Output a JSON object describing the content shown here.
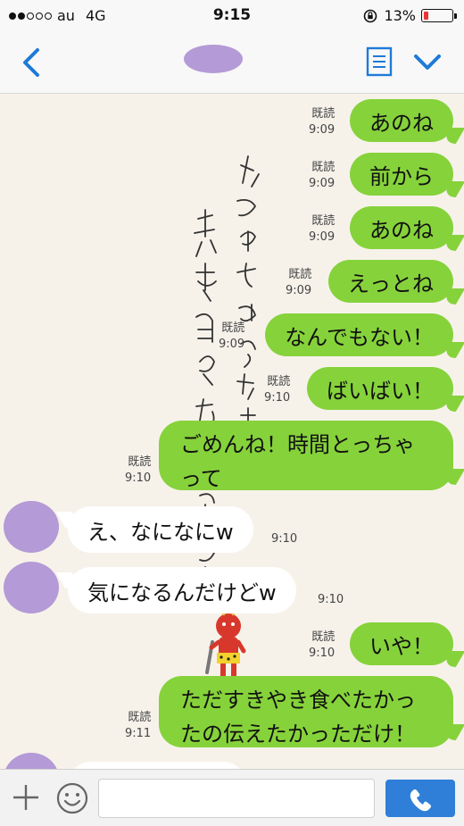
{
  "status_bar": {
    "carrier": "au",
    "network": "4G",
    "time": "9:15",
    "battery": "13%",
    "battery_level": 0.13,
    "signal_bars_filled": 2,
    "signal_bars_total": 5
  },
  "colors": {
    "outgoing_bubble": "#86d23b",
    "incoming_bubble": "#ffffff",
    "accent": "#1f7ad8",
    "avatar": "#b49ad6",
    "send_button": "#2f7fd8"
  },
  "messages": [
    {
      "dir": "out",
      "text": "あのね",
      "read": "既読",
      "time": "9:09"
    },
    {
      "dir": "out",
      "text": "前から",
      "read": "既読",
      "time": "9:09"
    },
    {
      "dir": "out",
      "text": "あのね",
      "read": "既読",
      "time": "9:09"
    },
    {
      "dir": "out",
      "text": "えっとね",
      "read": "既読",
      "time": "9:09"
    },
    {
      "dir": "out",
      "text": "なんでもない！",
      "read": "既読",
      "time": "9:09"
    },
    {
      "dir": "out",
      "text": "ばいばい！",
      "read": "既読",
      "time": "9:10"
    },
    {
      "dir": "out",
      "lines": [
        "ごめんね！時間とっちゃ",
        "って"
      ],
      "read": "既読",
      "time": "9:10"
    },
    {
      "dir": "in",
      "text": "え、なになにw",
      "time": "9:10"
    },
    {
      "dir": "in",
      "text": "気になるんだけどw",
      "time": "9:10"
    },
    {
      "dir": "out",
      "text": "いや！",
      "read": "既読",
      "time": "9:10"
    },
    {
      "dir": "out",
      "lines": [
        "ただすきやき食べたかっ",
        "たの伝えたかっただけ！"
      ],
      "read": "既読",
      "time": "9:11"
    }
  ],
  "icons": {
    "back": "chevron-left-icon",
    "memo": "note-icon",
    "menu": "chevron-down-icon",
    "plus": "plus-icon",
    "sticker": "smile-icon",
    "send": "phone-icon"
  }
}
